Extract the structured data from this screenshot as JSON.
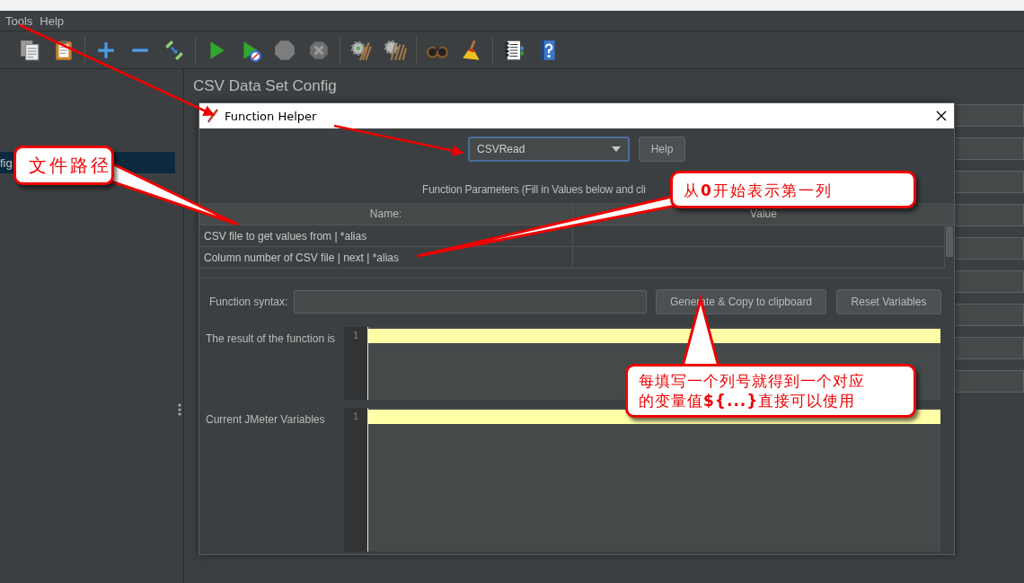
{
  "menu": [
    {
      "label": "Tools"
    },
    {
      "label": "Help"
    }
  ],
  "tree": {
    "items": [
      {
        "label": "fig",
        "selected": true
      }
    ]
  },
  "panel": {
    "title": "CSV Data Set Config"
  },
  "dialog": {
    "title": "Function Helper",
    "function": "CSVRead",
    "help_button": "Help",
    "parameters_caption": "Function Parameters (Fill in Values below and cli",
    "table": {
      "columns": [
        "Name:",
        "Value"
      ],
      "rows": [
        {
          "name": "CSV file to get values from | *alias"
        },
        {
          "name": "Column number of CSV file | next | *alias"
        }
      ]
    },
    "syntax_label": "Function syntax:",
    "buttons": [
      "Generate & Copy to clipboard",
      "Reset Variables"
    ],
    "editors": [
      {
        "label": "The result of the function is",
        "line_number": "1"
      },
      {
        "label": "Current JMeter Variables",
        "line_number": "1"
      }
    ]
  },
  "callouts": [
    {
      "text": "文件路径"
    },
    {
      "text": "从**0**开始表示第一列"
    },
    {
      "text": "每填写一个列号就得到一个对应的变量值**${...}**直接可以使用"
    }
  ]
}
